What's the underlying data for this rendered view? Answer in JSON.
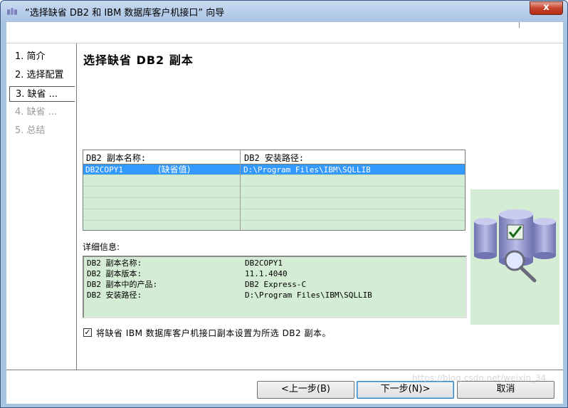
{
  "window": {
    "title": "“选择缺省 DB2 和 IBM 数据库客户机接口” 向导",
    "close_label": "x"
  },
  "nav": {
    "items": [
      {
        "label": "1. 简介"
      },
      {
        "label": "2. 选择配置"
      },
      {
        "label": "3. 缺省 ..."
      },
      {
        "label": "4. 缺省 ..."
      },
      {
        "label": "5. 总结"
      }
    ]
  },
  "page": {
    "title": "选择缺省 DB2 副本"
  },
  "copies_table": {
    "headers": [
      "DB2 副本名称:",
      "DB2 安装路径:"
    ],
    "rows": [
      {
        "name": "DB2COPY1",
        "default_tag": "(缺省值)",
        "path": "D:\\Program Files\\IBM\\SQLLIB",
        "selected": true
      }
    ]
  },
  "details": {
    "label": "详细信息:",
    "rows": [
      {
        "key": "DB2 副本名称:",
        "value": "DB2COPY1"
      },
      {
        "key": "DB2 副本版本:",
        "value": "11.1.4040"
      },
      {
        "key": "DB2 副本中的产品:",
        "value": "DB2 Express-C"
      },
      {
        "key": "DB2 安装路径:",
        "value": "D:\\Program Files\\IBM\\SQLLIB"
      }
    ]
  },
  "checkbox": {
    "checked_glyph": "✓",
    "label": "将缺省 IBM 数据库客户机接口副本设置为所选 DB2 副本。"
  },
  "buttons": {
    "back": "<上一步(B)",
    "next": "下一步(N)>",
    "cancel": "取消"
  },
  "watermark": "https://blog.csdn.net/weixin_34"
}
